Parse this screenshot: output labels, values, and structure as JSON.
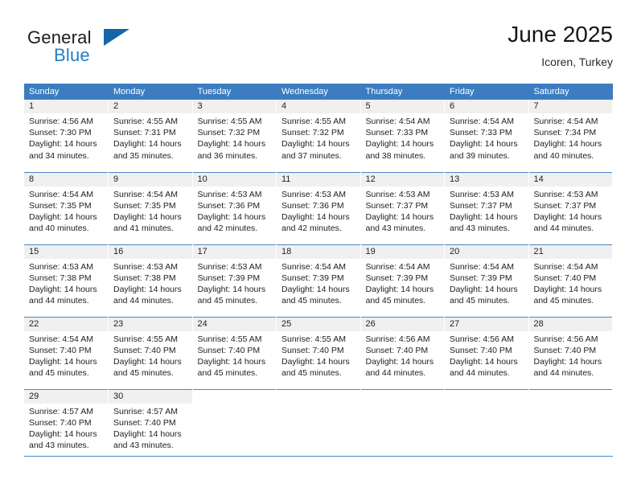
{
  "brand": {
    "name_part1": "General",
    "name_part2": "Blue",
    "flag_icon": "triangle-flag-icon",
    "accent_color": "#1f7ec4",
    "flag_color": "#1565a8"
  },
  "header": {
    "title": "June 2025",
    "subtitle": "Icoren, Turkey"
  },
  "colors": {
    "header_row_bg": "#3b7dc0",
    "daynum_bg": "#f0f0f0",
    "grid_line": "#4a86c5",
    "text": "#1e1e1e"
  },
  "calendar": {
    "weekday_headers": [
      "Sunday",
      "Monday",
      "Tuesday",
      "Wednesday",
      "Thursday",
      "Friday",
      "Saturday"
    ],
    "weeks": [
      [
        {
          "day": "1",
          "sunrise": "Sunrise: 4:56 AM",
          "sunset": "Sunset: 7:30 PM",
          "daylight_line1": "Daylight: 14 hours",
          "daylight_line2": "and 34 minutes."
        },
        {
          "day": "2",
          "sunrise": "Sunrise: 4:55 AM",
          "sunset": "Sunset: 7:31 PM",
          "daylight_line1": "Daylight: 14 hours",
          "daylight_line2": "and 35 minutes."
        },
        {
          "day": "3",
          "sunrise": "Sunrise: 4:55 AM",
          "sunset": "Sunset: 7:32 PM",
          "daylight_line1": "Daylight: 14 hours",
          "daylight_line2": "and 36 minutes."
        },
        {
          "day": "4",
          "sunrise": "Sunrise: 4:55 AM",
          "sunset": "Sunset: 7:32 PM",
          "daylight_line1": "Daylight: 14 hours",
          "daylight_line2": "and 37 minutes."
        },
        {
          "day": "5",
          "sunrise": "Sunrise: 4:54 AM",
          "sunset": "Sunset: 7:33 PM",
          "daylight_line1": "Daylight: 14 hours",
          "daylight_line2": "and 38 minutes."
        },
        {
          "day": "6",
          "sunrise": "Sunrise: 4:54 AM",
          "sunset": "Sunset: 7:33 PM",
          "daylight_line1": "Daylight: 14 hours",
          "daylight_line2": "and 39 minutes."
        },
        {
          "day": "7",
          "sunrise": "Sunrise: 4:54 AM",
          "sunset": "Sunset: 7:34 PM",
          "daylight_line1": "Daylight: 14 hours",
          "daylight_line2": "and 40 minutes."
        }
      ],
      [
        {
          "day": "8",
          "sunrise": "Sunrise: 4:54 AM",
          "sunset": "Sunset: 7:35 PM",
          "daylight_line1": "Daylight: 14 hours",
          "daylight_line2": "and 40 minutes."
        },
        {
          "day": "9",
          "sunrise": "Sunrise: 4:54 AM",
          "sunset": "Sunset: 7:35 PM",
          "daylight_line1": "Daylight: 14 hours",
          "daylight_line2": "and 41 minutes."
        },
        {
          "day": "10",
          "sunrise": "Sunrise: 4:53 AM",
          "sunset": "Sunset: 7:36 PM",
          "daylight_line1": "Daylight: 14 hours",
          "daylight_line2": "and 42 minutes."
        },
        {
          "day": "11",
          "sunrise": "Sunrise: 4:53 AM",
          "sunset": "Sunset: 7:36 PM",
          "daylight_line1": "Daylight: 14 hours",
          "daylight_line2": "and 42 minutes."
        },
        {
          "day": "12",
          "sunrise": "Sunrise: 4:53 AM",
          "sunset": "Sunset: 7:37 PM",
          "daylight_line1": "Daylight: 14 hours",
          "daylight_line2": "and 43 minutes."
        },
        {
          "day": "13",
          "sunrise": "Sunrise: 4:53 AM",
          "sunset": "Sunset: 7:37 PM",
          "daylight_line1": "Daylight: 14 hours",
          "daylight_line2": "and 43 minutes."
        },
        {
          "day": "14",
          "sunrise": "Sunrise: 4:53 AM",
          "sunset": "Sunset: 7:37 PM",
          "daylight_line1": "Daylight: 14 hours",
          "daylight_line2": "and 44 minutes."
        }
      ],
      [
        {
          "day": "15",
          "sunrise": "Sunrise: 4:53 AM",
          "sunset": "Sunset: 7:38 PM",
          "daylight_line1": "Daylight: 14 hours",
          "daylight_line2": "and 44 minutes."
        },
        {
          "day": "16",
          "sunrise": "Sunrise: 4:53 AM",
          "sunset": "Sunset: 7:38 PM",
          "daylight_line1": "Daylight: 14 hours",
          "daylight_line2": "and 44 minutes."
        },
        {
          "day": "17",
          "sunrise": "Sunrise: 4:53 AM",
          "sunset": "Sunset: 7:39 PM",
          "daylight_line1": "Daylight: 14 hours",
          "daylight_line2": "and 45 minutes."
        },
        {
          "day": "18",
          "sunrise": "Sunrise: 4:54 AM",
          "sunset": "Sunset: 7:39 PM",
          "daylight_line1": "Daylight: 14 hours",
          "daylight_line2": "and 45 minutes."
        },
        {
          "day": "19",
          "sunrise": "Sunrise: 4:54 AM",
          "sunset": "Sunset: 7:39 PM",
          "daylight_line1": "Daylight: 14 hours",
          "daylight_line2": "and 45 minutes."
        },
        {
          "day": "20",
          "sunrise": "Sunrise: 4:54 AM",
          "sunset": "Sunset: 7:39 PM",
          "daylight_line1": "Daylight: 14 hours",
          "daylight_line2": "and 45 minutes."
        },
        {
          "day": "21",
          "sunrise": "Sunrise: 4:54 AM",
          "sunset": "Sunset: 7:40 PM",
          "daylight_line1": "Daylight: 14 hours",
          "daylight_line2": "and 45 minutes."
        }
      ],
      [
        {
          "day": "22",
          "sunrise": "Sunrise: 4:54 AM",
          "sunset": "Sunset: 7:40 PM",
          "daylight_line1": "Daylight: 14 hours",
          "daylight_line2": "and 45 minutes."
        },
        {
          "day": "23",
          "sunrise": "Sunrise: 4:55 AM",
          "sunset": "Sunset: 7:40 PM",
          "daylight_line1": "Daylight: 14 hours",
          "daylight_line2": "and 45 minutes."
        },
        {
          "day": "24",
          "sunrise": "Sunrise: 4:55 AM",
          "sunset": "Sunset: 7:40 PM",
          "daylight_line1": "Daylight: 14 hours",
          "daylight_line2": "and 45 minutes."
        },
        {
          "day": "25",
          "sunrise": "Sunrise: 4:55 AM",
          "sunset": "Sunset: 7:40 PM",
          "daylight_line1": "Daylight: 14 hours",
          "daylight_line2": "and 45 minutes."
        },
        {
          "day": "26",
          "sunrise": "Sunrise: 4:56 AM",
          "sunset": "Sunset: 7:40 PM",
          "daylight_line1": "Daylight: 14 hours",
          "daylight_line2": "and 44 minutes."
        },
        {
          "day": "27",
          "sunrise": "Sunrise: 4:56 AM",
          "sunset": "Sunset: 7:40 PM",
          "daylight_line1": "Daylight: 14 hours",
          "daylight_line2": "and 44 minutes."
        },
        {
          "day": "28",
          "sunrise": "Sunrise: 4:56 AM",
          "sunset": "Sunset: 7:40 PM",
          "daylight_line1": "Daylight: 14 hours",
          "daylight_line2": "and 44 minutes."
        }
      ],
      [
        {
          "day": "29",
          "sunrise": "Sunrise: 4:57 AM",
          "sunset": "Sunset: 7:40 PM",
          "daylight_line1": "Daylight: 14 hours",
          "daylight_line2": "and 43 minutes."
        },
        {
          "day": "30",
          "sunrise": "Sunrise: 4:57 AM",
          "sunset": "Sunset: 7:40 PM",
          "daylight_line1": "Daylight: 14 hours",
          "daylight_line2": "and 43 minutes."
        },
        {
          "day": "",
          "sunrise": "",
          "sunset": "",
          "daylight_line1": "",
          "daylight_line2": ""
        },
        {
          "day": "",
          "sunrise": "",
          "sunset": "",
          "daylight_line1": "",
          "daylight_line2": ""
        },
        {
          "day": "",
          "sunrise": "",
          "sunset": "",
          "daylight_line1": "",
          "daylight_line2": ""
        },
        {
          "day": "",
          "sunrise": "",
          "sunset": "",
          "daylight_line1": "",
          "daylight_line2": ""
        },
        {
          "day": "",
          "sunrise": "",
          "sunset": "",
          "daylight_line1": "",
          "daylight_line2": ""
        }
      ]
    ]
  }
}
